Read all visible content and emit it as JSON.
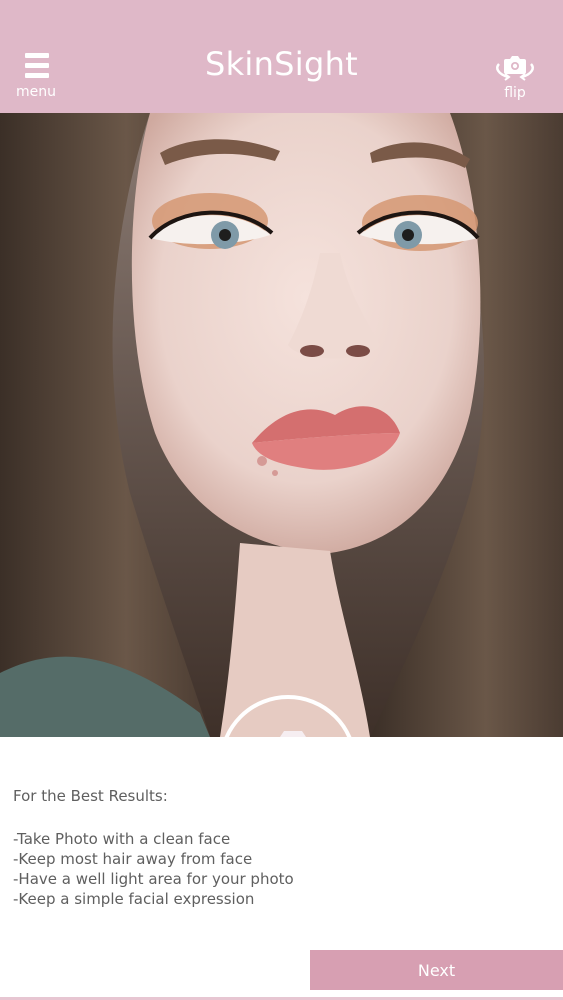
{
  "header": {
    "title": "SkinSight",
    "menu_label": "menu",
    "flip_label": "flip",
    "background_color": "#dfb8c8"
  },
  "camera": {
    "shutter_icon": "camera-icon"
  },
  "tips": {
    "heading": "For the Best Results:",
    "items": [
      "-Take Photo with a clean face",
      "-Keep most hair away from face",
      "-Have a well light area for your photo",
      "-Keep a simple facial expression"
    ]
  },
  "footer": {
    "next_label": "Next",
    "button_color": "#d79fb2"
  }
}
